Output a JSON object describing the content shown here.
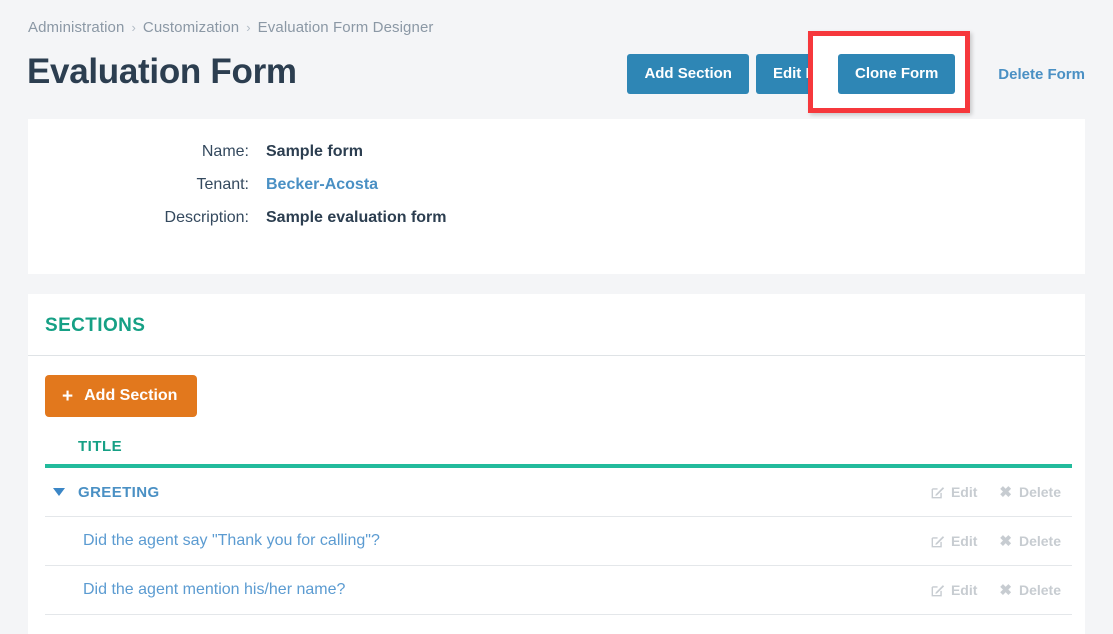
{
  "breadcrumb": {
    "separator": "›",
    "items": [
      {
        "label": "Administration"
      },
      {
        "label": "Customization"
      },
      {
        "label": "Evaluation Form Designer"
      }
    ]
  },
  "page": {
    "title": "Evaluation Form"
  },
  "header_actions": {
    "add_section_label": "Add Section",
    "edit_form_label": "Edit Form",
    "clone_form_label": "Clone Form",
    "delete_form_label": "Delete Form"
  },
  "highlight": {
    "target": "Clone Form",
    "color": "#f6383c"
  },
  "info": {
    "rows": [
      {
        "label": "Name:",
        "value": "Sample form",
        "is_link": false
      },
      {
        "label": "Tenant:",
        "value": "Becker-Acosta",
        "is_link": true
      },
      {
        "label": "Description:",
        "value": "Sample evaluation form",
        "is_link": false
      }
    ]
  },
  "sections": {
    "heading": "SECTIONS",
    "add_section_label": "Add Section",
    "add_icon": "plus-icon",
    "table": {
      "columns": [
        "TITLE"
      ],
      "rows": [
        {
          "type": "section",
          "title": "GREETING",
          "expanded": true,
          "caret_icon": "caret-down-icon",
          "edit_label": "Edit",
          "delete_label": "Delete"
        },
        {
          "type": "question",
          "title": "Did the agent say \"Thank you for calling\"?",
          "edit_label": "Edit",
          "delete_label": "Delete"
        },
        {
          "type": "question",
          "title": "Did the agent mention his/her name?",
          "edit_label": "Edit",
          "delete_label": "Delete"
        }
      ]
    }
  },
  "colors": {
    "page_background": "#f4f5f7",
    "card_background": "#ffffff",
    "primary_button": "#2e86b5",
    "accent_orange": "#e2781d",
    "accent_teal": "#16a085",
    "link_blue": "#4a90c4",
    "muted_action": "#c7ccd1",
    "highlight_red": "#f6383c"
  }
}
